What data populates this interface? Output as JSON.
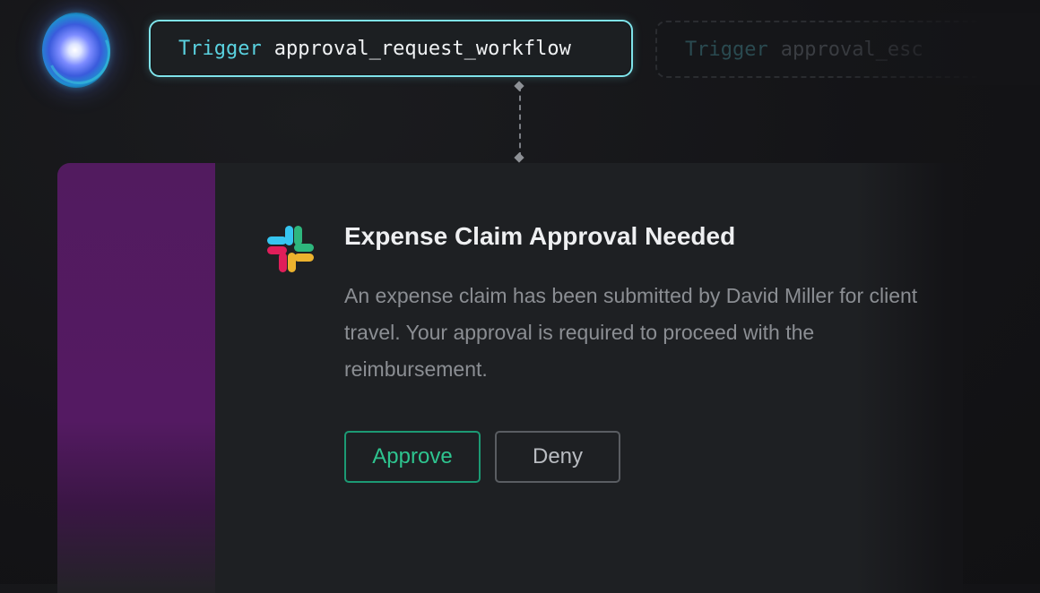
{
  "logo": {
    "icon": "ai-orb-icon"
  },
  "triggers": [
    {
      "keyword": "Trigger",
      "name": "approval_request_workflow",
      "state": "active"
    },
    {
      "keyword": "Trigger",
      "name": "approval_esc",
      "state": "inactive"
    }
  ],
  "message": {
    "app_icon": "slack-icon",
    "title": "Expense Claim Approval Needed",
    "body": "An expense claim has been submitted by David Miller for client travel. Your approval is required to proceed with the reimbursement.",
    "actions": {
      "approve_label": "Approve",
      "deny_label": "Deny"
    }
  },
  "colors": {
    "accent_cyan": "#5ad2e0",
    "approve_green": "#2ec48f",
    "slack_stripe": "#541a62"
  }
}
